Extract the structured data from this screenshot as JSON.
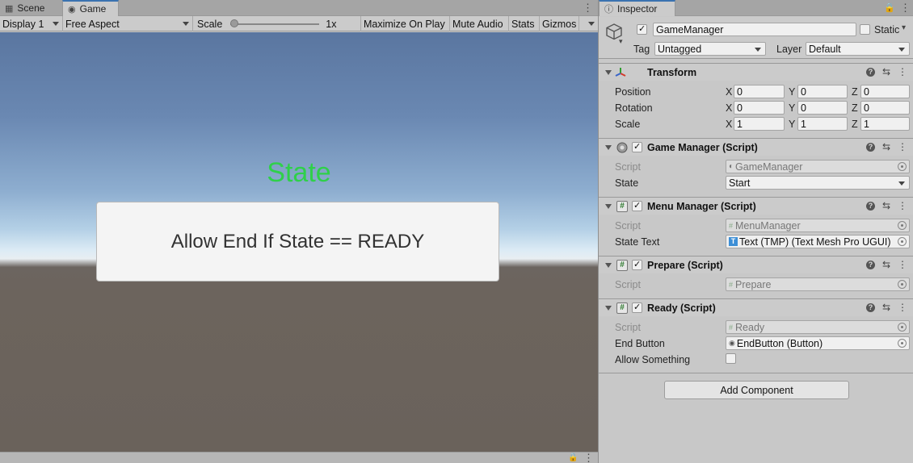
{
  "game_panel": {
    "tabs": [
      {
        "label": "Scene",
        "icon": "scene-grid-icon",
        "active": false
      },
      {
        "label": "Game",
        "icon": "gamepad-icon",
        "active": true
      }
    ],
    "toolbar": {
      "display": "Display 1",
      "aspect": "Free Aspect",
      "scale_label": "Scale",
      "scale_value": "1x",
      "scale_slider_position": 0.0,
      "maximize_on_play": "Maximize On Play",
      "mute_audio": "Mute Audio",
      "stats": "Stats",
      "gizmos": "Gizmos"
    },
    "viewport": {
      "state_text": "State",
      "state_text_color": "#2fd04a",
      "button_text": "Allow End If State == READY"
    }
  },
  "inspector": {
    "tab_label": "Inspector",
    "tab_icon": "info-icon",
    "gameobject": {
      "active": true,
      "name": "GameManager",
      "static_label": "Static",
      "static_checked": false,
      "tag_label": "Tag",
      "tag_value": "Untagged",
      "layer_label": "Layer",
      "layer_value": "Default"
    },
    "transform": {
      "title": "Transform",
      "rows": [
        {
          "label": "Position",
          "x": "0",
          "y": "0",
          "z": "0"
        },
        {
          "label": "Rotation",
          "x": "0",
          "y": "0",
          "z": "0"
        },
        {
          "label": "Scale",
          "x": "1",
          "y": "1",
          "z": "1"
        }
      ],
      "axis_labels": [
        "X",
        "Y",
        "Z"
      ]
    },
    "game_manager": {
      "title": "Game Manager (Script)",
      "enabled": true,
      "script_label": "Script",
      "script_value": "GameManager",
      "state_label": "State",
      "state_value": "Start"
    },
    "menu_manager": {
      "title": "Menu Manager (Script)",
      "enabled": true,
      "script_label": "Script",
      "script_value": "MenuManager",
      "state_text_label": "State Text",
      "state_text_value": "Text (TMP) (Text Mesh Pro UGUI)"
    },
    "prepare": {
      "title": "Prepare (Script)",
      "enabled": true,
      "script_label": "Script",
      "script_value": "Prepare"
    },
    "ready": {
      "title": "Ready (Script)",
      "enabled": true,
      "script_label": "Script",
      "script_value": "Ready",
      "end_button_label": "End Button",
      "end_button_value": "EndButton (Button)",
      "allow_something_label": "Allow Something",
      "allow_something_checked": false
    },
    "add_component_label": "Add Component"
  }
}
